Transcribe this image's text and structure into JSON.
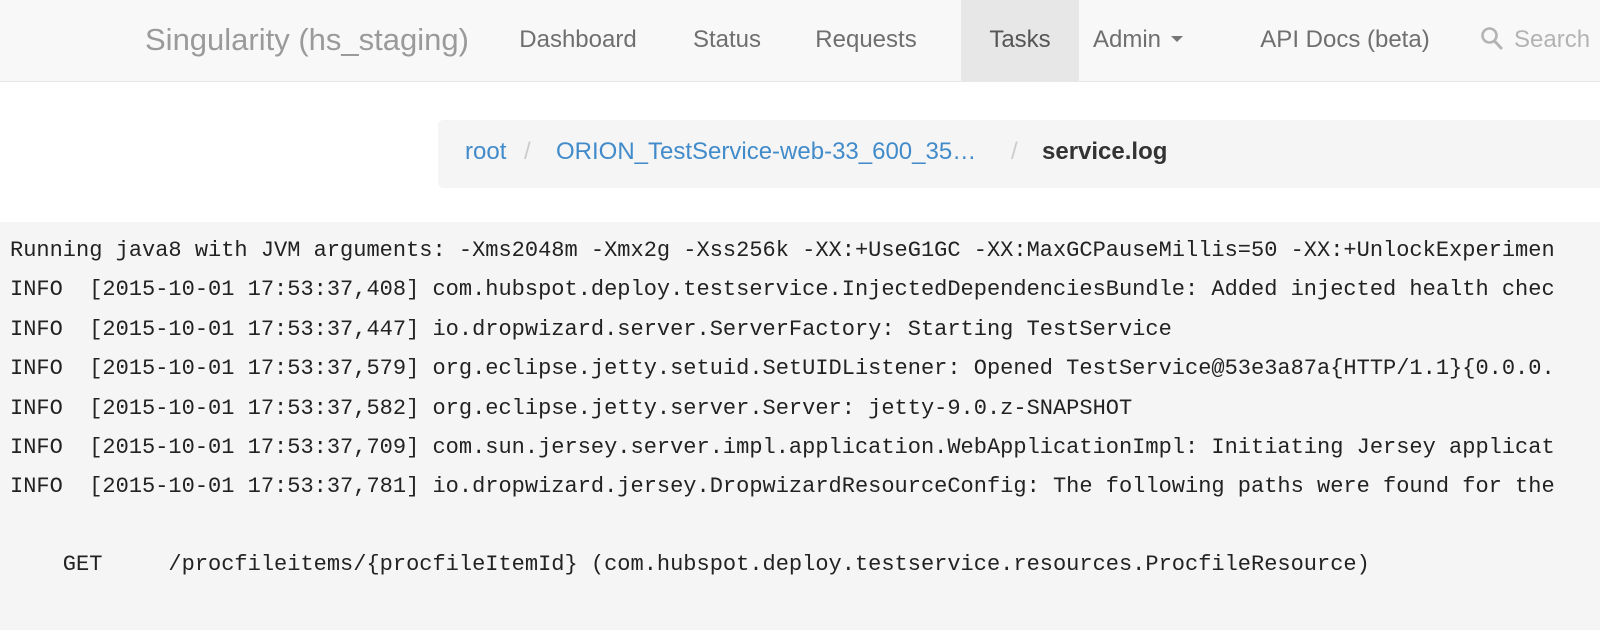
{
  "navbar": {
    "brand": "Singularity (hs_staging)",
    "items": [
      {
        "label": "Dashboard"
      },
      {
        "label": "Status"
      },
      {
        "label": "Requests"
      },
      {
        "label": "Tasks"
      },
      {
        "label": "Admin"
      },
      {
        "label": "API Docs (beta)"
      }
    ],
    "active_item": "Tasks",
    "search_label": "Search"
  },
  "breadcrumb": {
    "items": [
      {
        "label": "root"
      },
      {
        "label": "ORION_TestService-web-33_600_35…"
      },
      {
        "label": "service.log"
      }
    ],
    "separator": "/"
  },
  "log": {
    "lines": [
      "Running java8 with JVM arguments: -Xms2048m -Xmx2g -Xss256k -XX:+UseG1GC -XX:MaxGCPauseMillis=50 -XX:+UnlockExperimen",
      "INFO  [2015-10-01 17:53:37,408] com.hubspot.deploy.testservice.InjectedDependenciesBundle: Added injected health chec",
      "INFO  [2015-10-01 17:53:37,447] io.dropwizard.server.ServerFactory: Starting TestService",
      "INFO  [2015-10-01 17:53:37,579] org.eclipse.jetty.setuid.SetUIDListener: Opened TestService@53e3a87a{HTTP/1.1}{0.0.0.",
      "INFO  [2015-10-01 17:53:37,582] org.eclipse.jetty.server.Server: jetty-9.0.z-SNAPSHOT",
      "INFO  [2015-10-01 17:53:37,709] com.sun.jersey.server.impl.application.WebApplicationImpl: Initiating Jersey applicat",
      "INFO  [2015-10-01 17:53:37,781] io.dropwizard.jersey.DropwizardResourceConfig: The following paths were found for the",
      "",
      "    GET     /procfileitems/{procfileItemId} (com.hubspot.deploy.testservice.resources.ProcfileResource)"
    ]
  },
  "colors": {
    "link": "#428bca",
    "navbar_bg": "#f8f8f8",
    "active_tab_bg": "#e7e7e7",
    "log_bg": "#f5f5f5"
  }
}
